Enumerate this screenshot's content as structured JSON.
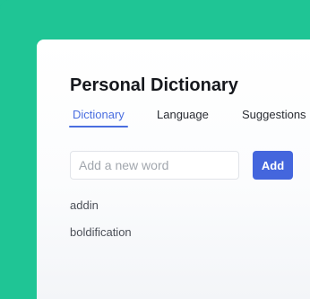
{
  "dictionary": {
    "title": "Personal Dictionary",
    "tabs": [
      {
        "label": "Dictionary",
        "active": true
      },
      {
        "label": "Language",
        "active": false
      },
      {
        "label": "Suggestions",
        "active": false
      }
    ],
    "new_word": {
      "value": "",
      "placeholder": "Add a new word"
    },
    "add_label": "Add",
    "words": [
      "addin",
      "boldification"
    ]
  },
  "colors": {
    "backdrop": "#1fc595",
    "accent": "#4a6ee0",
    "button": "#4466dd"
  }
}
